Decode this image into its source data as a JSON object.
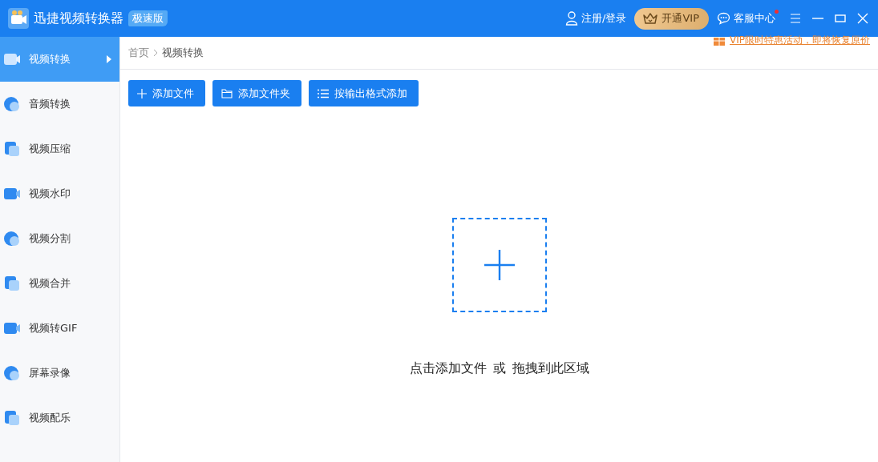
{
  "window": {
    "title": "迅捷视频转换器",
    "edition_badge": "极速版"
  },
  "header": {
    "login": "注册/登录",
    "vip_button": "开通VIP",
    "support": "客服中心",
    "support_unread": true
  },
  "promo": "VIP限时特惠活动，即将恢复原价",
  "sidebar": {
    "items": [
      {
        "label": "视频转换",
        "selected": true
      },
      {
        "label": "音频转换",
        "selected": false
      },
      {
        "label": "视频压缩",
        "selected": false
      },
      {
        "label": "视频水印",
        "selected": false
      },
      {
        "label": "视频分割",
        "selected": false
      },
      {
        "label": "视频合并",
        "selected": false
      },
      {
        "label": "视频转GIF",
        "selected": false
      },
      {
        "label": "屏幕录像",
        "selected": false
      },
      {
        "label": "视频配乐",
        "selected": false
      }
    ]
  },
  "breadcrumb": [
    "首页",
    "视频转换"
  ],
  "toolbar": [
    {
      "kind": "file",
      "label": "添加文件"
    },
    {
      "kind": "folder",
      "label": "添加文件夹"
    },
    {
      "kind": "format",
      "label": "按输出格式添加"
    }
  ],
  "dropzone": {
    "hint_main": "点击添加文件",
    "hint_or": "或",
    "hint_drag": "拖拽到此区域"
  }
}
